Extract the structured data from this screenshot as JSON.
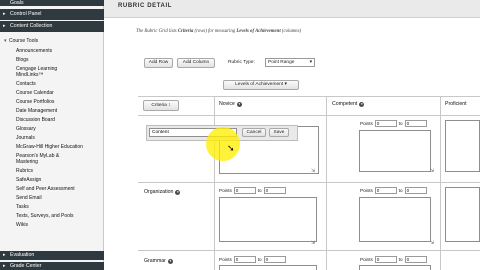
{
  "sidebar": {
    "header_top": "Goals",
    "items_top": [
      {
        "label": "Control Panel"
      },
      {
        "label": "Content Collection"
      }
    ],
    "course_tools_label": "Course Tools",
    "tools": [
      "Announcements",
      "Blogs",
      "Cengage Learning",
      "MindLinks™",
      "Contacts",
      "Course Calendar",
      "Course Portfolios",
      "Date Management",
      "Discussion Board",
      "Glossary",
      "Journals",
      "McGraw-Hill Higher Education",
      "Pearson's MyLab &",
      "Mastering",
      "Rubrics",
      "SafeAssign",
      "Self and Peer Assessment",
      "Send Email",
      "Tasks",
      "Tests, Surveys, and Pools",
      "Wikis"
    ],
    "bottom_items": [
      "Evaluation",
      "Grade Center"
    ]
  },
  "main": {
    "title": "RUBRIC DETAIL",
    "note_prefix": "The Rubric Grid lists",
    "note_criteria": "Criteria",
    "note_mid": "(rows) for measuring",
    "note_levels": "Levels of Achievement",
    "note_suffix": "(columns)",
    "add_row_label": "Add Row",
    "add_column_label": "Add Column",
    "rubric_type_label": "Rubric Type:",
    "rubric_type_value": "Point Range",
    "levels_button": "Levels of Achievement",
    "criteria_button": "Criteria",
    "columns": [
      "Novice",
      "Competent",
      "Proficient"
    ],
    "rows": [
      "Organization",
      "Grammar"
    ],
    "edit_value": "Content",
    "cancel_label": "Cancel",
    "save_label": "Save",
    "points_label": "Points",
    "to_label": "to",
    "novice_row1": {
      "from": "0",
      "to": "0"
    },
    "competent_row0": {
      "from": "0",
      "to": "0"
    },
    "competent_row1": {
      "from": "0",
      "to": "0"
    },
    "novice_row2": {
      "from": "0",
      "to": "0"
    },
    "competent_row2": {
      "from": "0",
      "to": "0"
    }
  }
}
